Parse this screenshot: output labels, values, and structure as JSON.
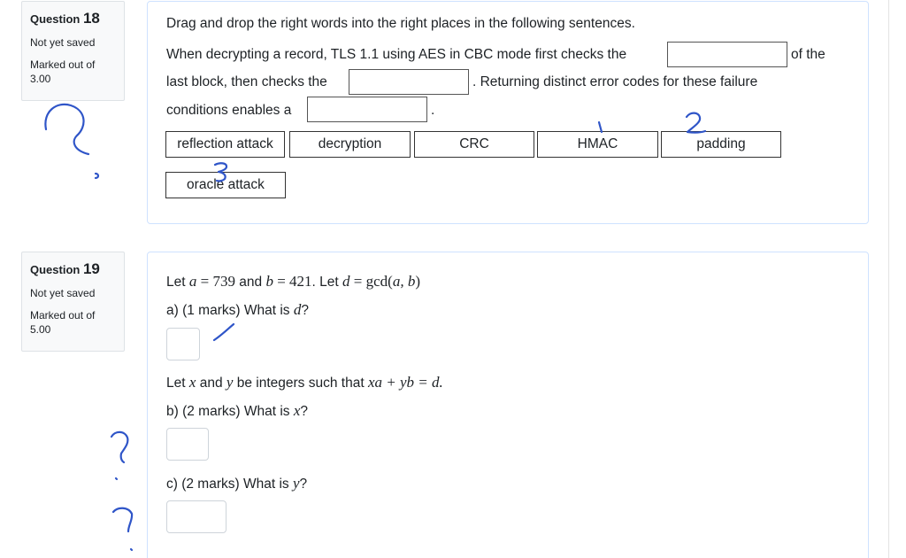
{
  "q18": {
    "label": "Question",
    "number": "18",
    "state": "Not yet saved",
    "marks_label": "Marked out of",
    "marks_value": "3.00",
    "instructions": "Drag and drop the right words into the right places in the following sentences.",
    "s1_part1": "When decrypting a record, TLS 1.1 using AES in CBC mode first checks the",
    "s1_part2": "of the",
    "s2_part1": "last block, then checks the",
    "s2_part2": ". Returning distinct error codes for these failure",
    "s3_part1": "conditions enables a",
    "s3_part2": ".",
    "choices": [
      "reflection attack",
      "decryption",
      "CRC",
      "HMAC",
      "padding",
      "oracle attack"
    ],
    "annotations": {
      "hmac": "1",
      "padding": "2",
      "oracle": "3"
    }
  },
  "q19": {
    "label": "Question",
    "number": "19",
    "state": "Not yet saved",
    "marks_label": "Marked out of",
    "marks_value": "5.00",
    "intro_let": "Let",
    "a_var": "a",
    "eq_a": " = 739",
    "and1": " and ",
    "b_var": "b",
    "eq_b": " = 421",
    "let_d": ". Let ",
    "d_var": "d",
    "eq_d": " = gcd(",
    "gcd_args": "a, b",
    "close_paren": ")",
    "part_a_text": "a) (1 marks) What is ",
    "part_a_var": "d",
    "part_a_q": "?",
    "let2": "Let ",
    "x_var": "x",
    "and2": " and ",
    "y_var": "y",
    "let2_rest": " be integers such  that ",
    "eqn": "xa + yb = d.",
    "part_b_text": "b) (2 marks) What is ",
    "part_b_var": "x",
    "part_b_q": "?",
    "part_c_text": "c) (2 marks) What is ",
    "part_c_var": "y",
    "part_c_q": "?"
  }
}
